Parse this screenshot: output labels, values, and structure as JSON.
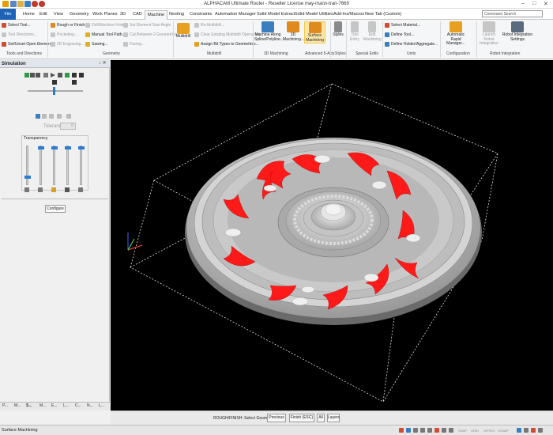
{
  "window": {
    "title": "ALPHACAM Ultimate Router - Reseller License may-mann-tran-7669"
  },
  "menu": {
    "tabs": [
      "File",
      "Home",
      "Edit",
      "View",
      "Geometry",
      "Work Planes",
      "3D",
      "CAD",
      "Machine",
      "Nesting",
      "Constraints",
      "Automation Manager",
      "Solid Model Extract",
      "Solid Model Utilities",
      "Add-Ins/Macros",
      "New Tab (Custom)"
    ],
    "active": "Machine",
    "search_placeholder": "Command Search"
  },
  "ribbon": {
    "groups": [
      {
        "label": "Tools and Directions",
        "items": [
          "Select Tool...",
          "Tool Directions...",
          "Set/Unset Open Elements"
        ]
      },
      {
        "label": "Geometry",
        "items": [
          "Rough or Finish...",
          "Pocketing...",
          "3D Engraving...",
          "Drill/Machine Holes",
          "Manual Tool Path...",
          "Sawing...",
          "Set Element Saw Angle",
          "Cut Between 2 Geometries...",
          "Facing..."
        ]
      },
      {
        "label": "Multidrill",
        "items": [
          "Multidrill",
          "Re-Multidrill...",
          "Clear Existing Multidrill Operations",
          "Assign Bit Types to Geometries..."
        ]
      },
      {
        "label": "3D Machining",
        "items": [
          "Machine Along Spline/Polyline...",
          "3D Machining...",
          "Surface Machining"
        ]
      },
      {
        "label": "Advanced 5-Axis",
        "items": []
      },
      {
        "label": "Styles",
        "items": [
          "Styles"
        ]
      },
      {
        "label": "Special Edits",
        "items": [
          "Tool Entry",
          "Edit Machining"
        ]
      },
      {
        "label": "Units",
        "items": [
          "Select Material...",
          "Define Tool...",
          "Define Holder/Aggregate..."
        ]
      },
      {
        "label": "Configuration",
        "items": [
          "Automatic Rapid Manager..."
        ]
      },
      {
        "label": "Robot Integration",
        "items": [
          "Launch Robot Integration",
          "Robot Integration Settings"
        ]
      }
    ]
  },
  "simulation": {
    "title": "Simulation",
    "pin": "↓ ✕",
    "tolerance_label": "Tolerance",
    "tolerance_value": "0",
    "transparency_label": "Transparency",
    "transparency_levels": [
      0.15,
      1.0,
      1.0,
      1.0,
      1.0
    ],
    "configure_label": "Configure"
  },
  "pane_tabs": [
    "P...",
    "M...",
    "S...",
    "M...",
    "E...",
    "L...",
    "C...",
    "N...",
    "L..."
  ],
  "command_bar": {
    "prompt": "ROUGH/FINISH: Select Geometries",
    "buttons": [
      "Previous",
      "Finish (ESC)",
      "All",
      "Layers"
    ]
  },
  "status": {
    "text": "Surface Machining",
    "indicators": [
      "SNAP",
      "GRID",
      "ORTHO",
      "OSNAP"
    ]
  },
  "colors": {
    "accent": "#1d63b7",
    "selected_geometry": "#ff1a1a",
    "part": "#c8c8c8"
  }
}
